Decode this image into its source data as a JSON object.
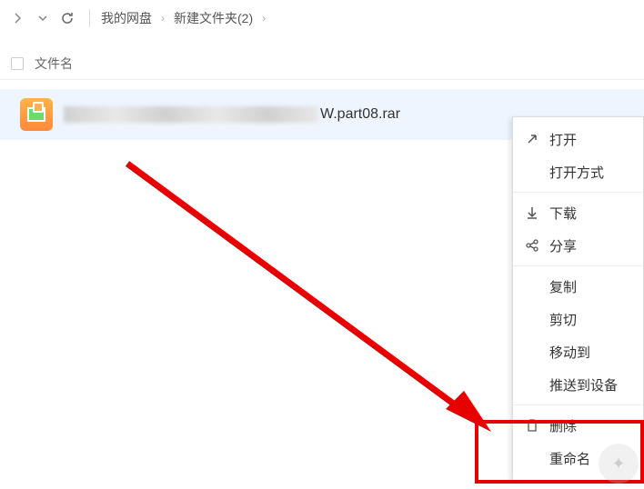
{
  "toolbar": {
    "breadcrumb": [
      "我的网盘",
      "新建文件夹(2)"
    ]
  },
  "header": {
    "filename_col": "文件名"
  },
  "file": {
    "name_suffix": "W.part08.rar"
  },
  "context_menu": {
    "open": "打开",
    "open_with": "打开方式",
    "download": "下载",
    "share": "分享",
    "copy": "复制",
    "cut": "剪切",
    "move_to": "移动到",
    "push_to_device": "推送到设备",
    "delete": "删除",
    "rename": "重命名"
  }
}
